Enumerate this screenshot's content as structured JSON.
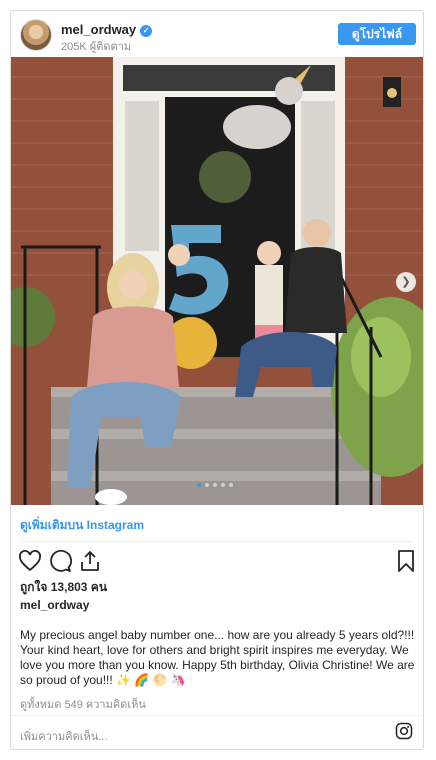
{
  "post": {
    "username": "mel_ordway",
    "followers": "205K ผู้ติดตาม",
    "profile_button": "ดูโปรไฟล์",
    "view_more": "ดูเพิ่มเติมบน Instagram",
    "likes": "ถูกใจ 13,803 คน",
    "caption_user": "mel_ordway",
    "caption": "My precious angel baby number one... how are you already 5 years old?!!! Your kind heart, love for others and bright spirit inspires me everyday. We love you more than you know. Happy 5th birthday, Olivia Christine! We are so proud of you!!! ✨ 🌈 🌕 🦄",
    "view_comments": "ดูทั้งหมด 549 ความคิดเห็น",
    "add_comment": "เพิ่มความคิดเห็น...",
    "carousel": {
      "total": 5,
      "current": 1
    }
  },
  "icons": {
    "verified": "verified-badge-icon",
    "heart": "heart-icon",
    "comment": "comment-icon",
    "share": "share-icon",
    "bookmark": "bookmark-icon",
    "instagram": "instagram-icon",
    "next": "chevron-right-icon"
  },
  "colors": {
    "accent": "#3897f0",
    "muted": "#8e8e8e",
    "text": "#262626"
  }
}
